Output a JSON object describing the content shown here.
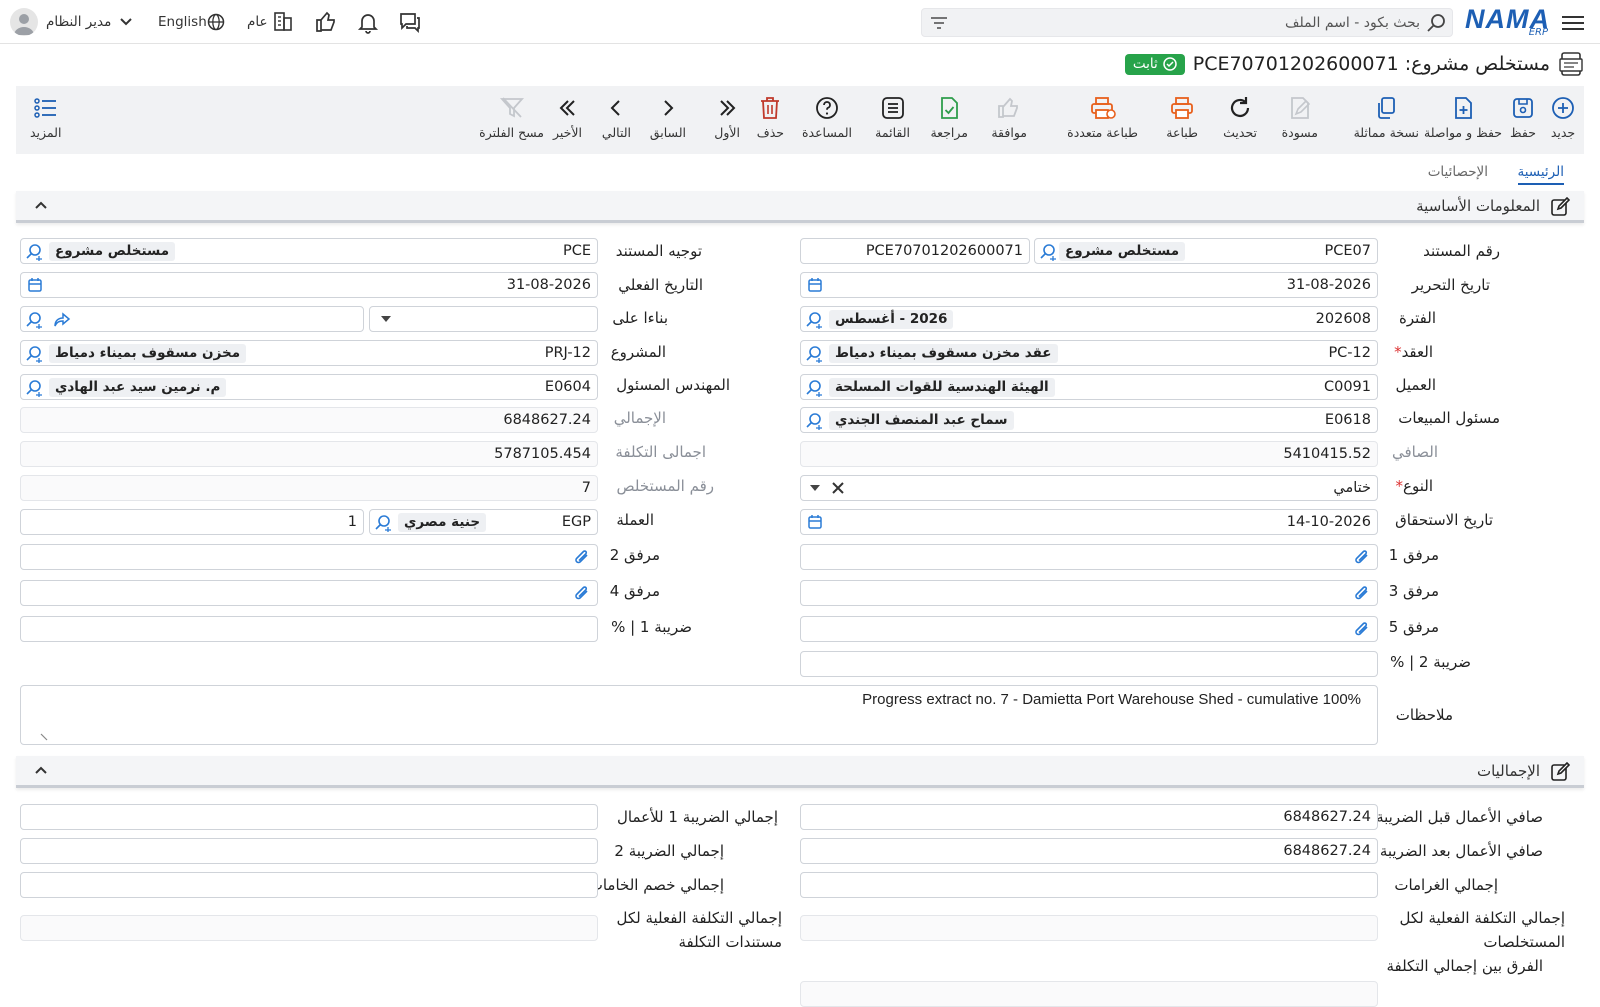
{
  "app": {
    "logo": "NAMA",
    "logo_sub": "ERP"
  },
  "topbar": {
    "search_placeholder": "بحث بكود - اسم الملف",
    "company_label": "عام",
    "language_label": "English",
    "user_name": "مدير النظام"
  },
  "page": {
    "title": "مستخلص مشروع: PCE70701202600071",
    "status_badge": "ثابت"
  },
  "toolbar": {
    "new": "جديد",
    "save": "حفظ",
    "save_continue": "حفظ و مواصلة",
    "duplicate": "نسخة مماثلة",
    "draft": "مسودة",
    "refresh": "تحديث",
    "print": "طباعة",
    "multi_print": "طباعة متعددة",
    "approve": "موافقة",
    "review": "مراجعة",
    "list": "القائمة",
    "help": "المساعدة",
    "delete": "حذف",
    "first": "الأول",
    "previous": "السابق",
    "next": "التالي",
    "last": "الأخير",
    "clear_filter": "مسح الفلترة",
    "more": "المزيد"
  },
  "tabs": {
    "main": "الرئيسية",
    "stats": "الإحصائيات"
  },
  "sections": {
    "basic": "المعلومات الأساسية",
    "totals": "الإجماليات"
  },
  "form": {
    "doc_no_label": "رقم المستند",
    "doc_no_code": "PCE07",
    "doc_no_chip": "مستخلص مشروع",
    "doc_no_value": "PCE70701202600071",
    "doc_direction_label": "توجيه المستند",
    "doc_direction_code": "PCE",
    "doc_direction_chip": "مستخلص مشروع",
    "edit_date_label": "تاريخ التحرير",
    "edit_date_value": "31-08-2026",
    "actual_date_label": "التاريخ الفعلي",
    "actual_date_value": "31-08-2026",
    "period_label": "الفترة",
    "period_code": "202608",
    "period_chip": "2026 - أغسطس",
    "based_on_label": "بناءا على",
    "contract_label": "العقد",
    "contract_code": "PC-12",
    "contract_chip": "عقد مخزن مسقوف بميناء دمياط",
    "project_label": "المشروع",
    "project_code": "PRJ-12",
    "project_chip": "مخزن مسقوف بميناء دمياط",
    "customer_label": "العميل",
    "customer_code": "C0091",
    "customer_chip": "الهيئة الهندسية للقوات المسلحة",
    "engineer_label": "المهندس المسئول",
    "engineer_code": "E0604",
    "engineer_chip": "م. نرمين سيد عبد الهادي",
    "sales_label": "مسئول المبيعات",
    "sales_code": "E0618",
    "sales_chip": "سماح عبد المنصف الجندي",
    "total_label": "الإجمالي",
    "total_value": "6848627.24",
    "net_label": "الصافي",
    "net_value": "5410415.52",
    "cost_total_label": "اجمالى التكلفة",
    "cost_total_value": "5787105.454",
    "type_label": "النوع",
    "type_value": "ختامي",
    "extract_no_label": "رقم المستخلص",
    "extract_no_value": "7",
    "due_date_label": "تاريخ الاستحقاق",
    "due_date_value": "14-10-2026",
    "currency_label": "العملة",
    "currency_code": "EGP",
    "currency_chip": "جنية مصري",
    "currency_rate": "1",
    "att1_label": "مرفق 1",
    "att2_label": "مرفق 2",
    "att3_label": "مرفق 3",
    "att4_label": "مرفق 4",
    "att5_label": "مرفق 5",
    "tax1_label": "ضريبة 1 | %",
    "tax2_label": "ضريبة 2 | %",
    "notes_label": "ملاحظات",
    "notes_value": "Progress extract no. 7 - Damietta Port Warehouse Shed - cumulative 100%"
  },
  "totals": {
    "net_before_tax_label": "صافي الأعمال قبل الضريبة",
    "net_before_tax_value": "6848627.24",
    "net_after_tax_label": "صافي الأعمال بعد الضريبة",
    "net_after_tax_value": "6848627.24",
    "penalties_label": "إجمالي الغرامات",
    "actual_cost_all_label_1": "إجمالي التكلفة الفعلية لكل",
    "actual_cost_all_label_2": "المستخلصات",
    "diff_label_1": "الفرق بين إجمالي التكلفة",
    "tax1_total_label": "إجمالي الضريبة 1 للأعمال",
    "tax2_total_label": "إجمالي الضريبة 2",
    "materials_label": "إجمالي خصم الخامات",
    "cost_docs_label_1": "إجمالي التكلفة الفعلية لكل",
    "cost_docs_label_2": "مستندات التكلفة"
  },
  "colors": {
    "brand": "#1d5fb4",
    "status_green": "#27a34a",
    "print_orange": "#e8601c",
    "delete_red": "#c0392b",
    "check_green": "#2e9d4b"
  }
}
